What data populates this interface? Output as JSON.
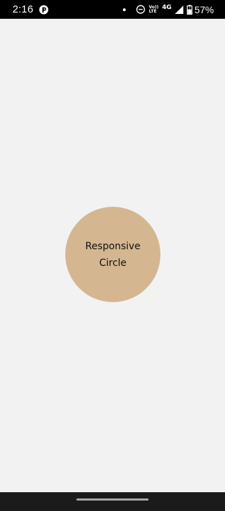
{
  "status_bar": {
    "time": "2:16",
    "network_line1": "Vo))",
    "network_line2": "LTE",
    "network_type": "4G",
    "battery_percent": "57%",
    "battery_level": 0.57
  },
  "main": {
    "circle_text": "Responsive Circle",
    "circle_color": "#d4b690"
  },
  "nav_bar": {
    "indicator_color": "#a9a9a9"
  }
}
